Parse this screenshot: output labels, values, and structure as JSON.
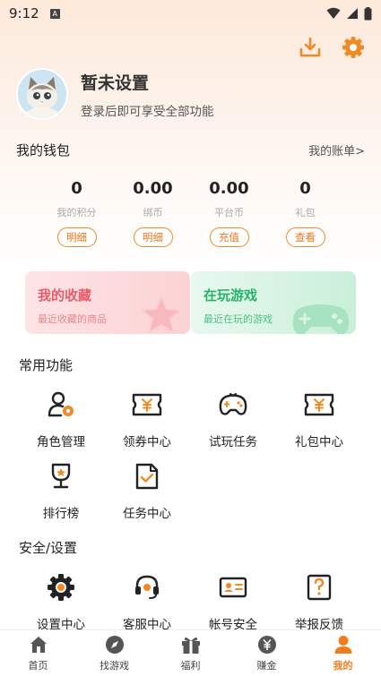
{
  "status": {
    "time": "9:12",
    "a_icon": "A"
  },
  "colors": {
    "accent": "#f08a24",
    "fav": "#e85c6a",
    "play": "#27b46a"
  },
  "top_actions": [
    {
      "name": "download-icon"
    },
    {
      "name": "settings-gear-icon"
    }
  ],
  "profile": {
    "name": "暂未设置",
    "subtitle": "登录后即可享受全部功能"
  },
  "wallet": {
    "title": "我的钱包",
    "link": "我的账单>",
    "items": [
      {
        "value": "0",
        "label": "我的积分",
        "button": "明细"
      },
      {
        "value": "0.00",
        "label": "绑币",
        "button": "明细"
      },
      {
        "value": "0.00",
        "label": "平台币",
        "button": "充值"
      },
      {
        "value": "0",
        "label": "礼包",
        "button": "查看"
      }
    ]
  },
  "cards": {
    "favorites": {
      "title": "我的收藏",
      "subtitle": "最近收藏的商品"
    },
    "playing": {
      "title": "在玩游戏",
      "subtitle": "最近在玩的游戏"
    }
  },
  "common": {
    "title": "常用功能",
    "items": [
      {
        "label": "角色管理",
        "icon": "role-manage-icon"
      },
      {
        "label": "领券中心",
        "icon": "coupon-icon"
      },
      {
        "label": "试玩任务",
        "icon": "gamepad-icon"
      },
      {
        "label": "礼包中心",
        "icon": "gift-pack-icon"
      },
      {
        "label": "排行榜",
        "icon": "trophy-icon"
      },
      {
        "label": "任务中心",
        "icon": "task-icon"
      }
    ]
  },
  "security": {
    "title": "安全/设置",
    "items": [
      {
        "label": "设置中心",
        "icon": "settings-icon"
      },
      {
        "label": "客服中心",
        "icon": "headset-icon"
      },
      {
        "label": "帐号安全",
        "icon": "id-card-icon"
      },
      {
        "label": "举报反馈",
        "icon": "report-icon"
      }
    ]
  },
  "nav": [
    {
      "label": "首页",
      "icon": "home-icon"
    },
    {
      "label": "找游戏",
      "icon": "compass-icon"
    },
    {
      "label": "福利",
      "icon": "gift-icon"
    },
    {
      "label": "赚金",
      "icon": "coin-icon"
    },
    {
      "label": "我的",
      "icon": "user-icon",
      "active": true
    }
  ]
}
